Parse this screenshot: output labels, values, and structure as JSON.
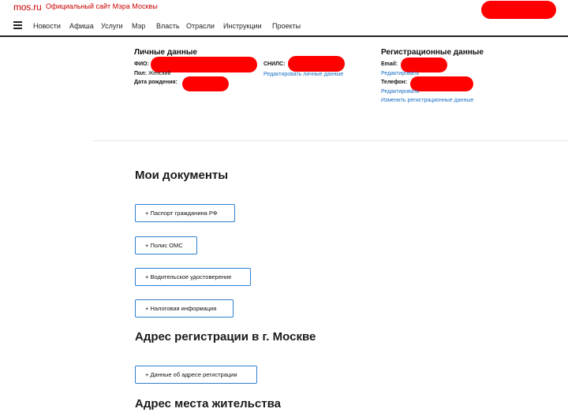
{
  "header": {
    "logo": "mos.ru",
    "site_title": "Официальный сайт Мэра Москвы"
  },
  "nav": {
    "menu_icon": "hamburger-icon",
    "items": [
      "Новости",
      "Афиша",
      "Услуги",
      "Мэр",
      "Власть",
      "Отрасли",
      "Инструкции",
      "Проекты"
    ]
  },
  "personal": {
    "title": "Личные данные",
    "fio_label": "ФИО:",
    "gender_label": "Пол:",
    "gender_value": "Женский",
    "birth_label": "Дата рождения:",
    "snils_label": "СНИЛС:",
    "edit_link": "Редактировать личные данные"
  },
  "registration": {
    "title": "Регистрационные данные",
    "email_label": "Email:",
    "edit_email": "Редактировать",
    "phone_label": "Телефон:",
    "edit_phone": "Редактировать",
    "change_link": "Изменить регистрационные данные"
  },
  "documents": {
    "title": "Мои документы",
    "buttons": [
      "+ Паспорт гражданина РФ",
      "+ Полис ОМС",
      "+ Водительское удостоверение",
      "+ Налоговая информация"
    ]
  },
  "address_reg": {
    "title": "Адрес регистрации в г. Москве",
    "button": "+ Данные об адресе регистрации"
  },
  "address_live": {
    "title": "Адрес места жительства"
  },
  "colors": {
    "brand": "#cc0000",
    "link": "#1a6fc4",
    "redaction": "#ff0000",
    "button_border": "#2c7fd0"
  }
}
